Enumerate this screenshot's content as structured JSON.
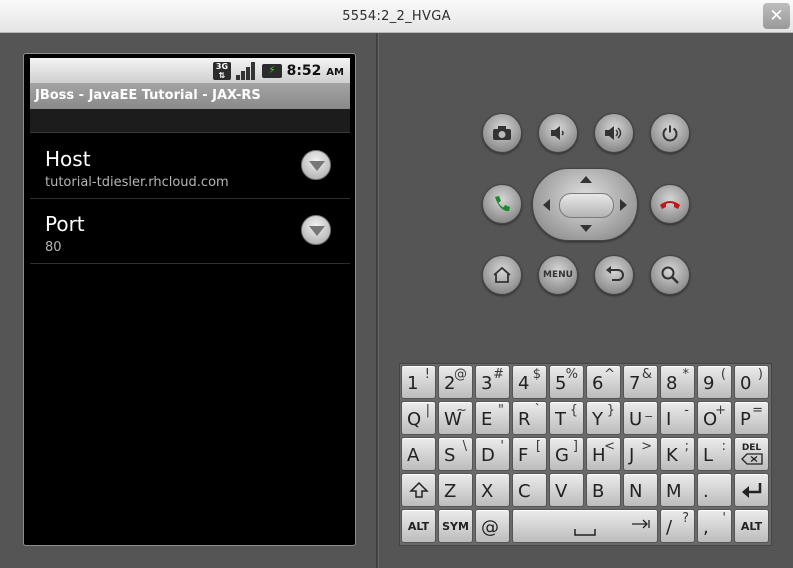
{
  "window": {
    "title": "5554:2_2_HVGA",
    "close_icon": "close-icon",
    "close_glyph": "✕"
  },
  "statusbar": {
    "network_label": "3G",
    "time": "8:52",
    "ampm": "AM"
  },
  "app": {
    "title": "JBoss - JavaEE Tutorial - JAX-RS"
  },
  "preferences": [
    {
      "title": "Host",
      "summary": "tutorial-tdiesler.rhcloud.com"
    },
    {
      "title": "Port",
      "summary": "80"
    }
  ],
  "controls": {
    "menu_label": "MENU"
  },
  "keyboard": {
    "row1": [
      {
        "main": "1",
        "sub": "!"
      },
      {
        "main": "2",
        "sub": "@"
      },
      {
        "main": "3",
        "sub": "#"
      },
      {
        "main": "4",
        "sub": "$"
      },
      {
        "main": "5",
        "sub": "%"
      },
      {
        "main": "6",
        "sub": "^"
      },
      {
        "main": "7",
        "sub": "&"
      },
      {
        "main": "8",
        "sub": "*"
      },
      {
        "main": "9",
        "sub": "("
      },
      {
        "main": "0",
        "sub": ")"
      }
    ],
    "row2": [
      {
        "main": "Q",
        "sub": "|"
      },
      {
        "main": "W",
        "sub": "~"
      },
      {
        "main": "E",
        "sub": "\""
      },
      {
        "main": "R",
        "sub": "`"
      },
      {
        "main": "T",
        "sub": "{"
      },
      {
        "main": "Y",
        "sub": "}"
      },
      {
        "main": "U",
        "sub": "_"
      },
      {
        "main": "I",
        "sub": "-"
      },
      {
        "main": "O",
        "sub": "+"
      },
      {
        "main": "P",
        "sub": "="
      }
    ],
    "row3": [
      {
        "main": "A",
        "sub": ""
      },
      {
        "main": "S",
        "sub": "\\"
      },
      {
        "main": "D",
        "sub": "'"
      },
      {
        "main": "F",
        "sub": "["
      },
      {
        "main": "G",
        "sub": "]"
      },
      {
        "main": "H",
        "sub": "<"
      },
      {
        "main": "J",
        "sub": ">"
      },
      {
        "main": "K",
        "sub": ";"
      },
      {
        "main": "L",
        "sub": ":"
      }
    ],
    "del_label": "DEL",
    "row4": [
      {
        "main": "Z"
      },
      {
        "main": "X"
      },
      {
        "main": "C"
      },
      {
        "main": "V"
      },
      {
        "main": "B"
      },
      {
        "main": "N"
      },
      {
        "main": "M"
      },
      {
        "main": "."
      }
    ],
    "alt_label": "ALT",
    "sym_label": "SYM",
    "at_label": "@",
    "slash_main": "/",
    "slash_sub": "?",
    "comma_main": ",",
    "comma_sub": "'"
  }
}
